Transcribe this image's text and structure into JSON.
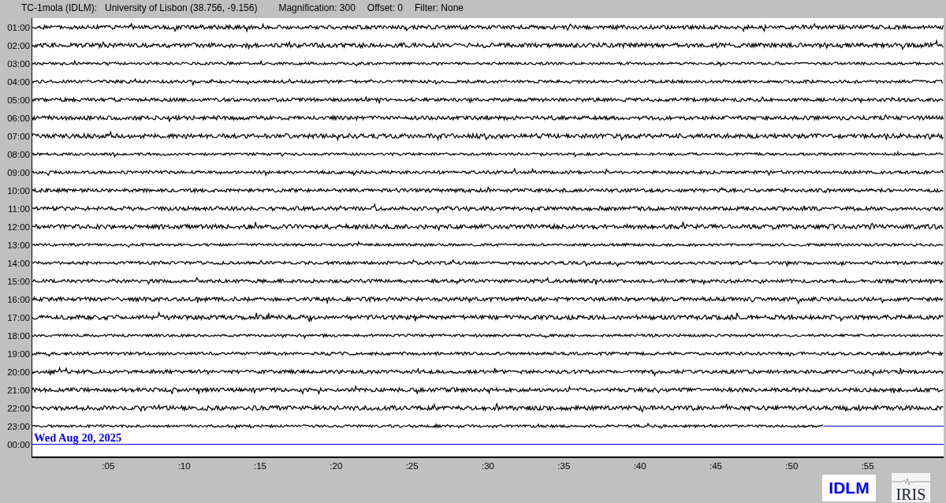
{
  "header": {
    "station": "TC-1mola (IDLM):",
    "location": "University of Lisbon (38.756, -9.156)",
    "magnification": "Magnification: 300",
    "offset": "Offset: 0",
    "filter": "Filter: None"
  },
  "rows": [
    {
      "time": "01:00",
      "kind": "trace"
    },
    {
      "time": "02:00",
      "kind": "trace"
    },
    {
      "time": "03:00",
      "kind": "trace"
    },
    {
      "time": "04:00",
      "kind": "trace"
    },
    {
      "time": "05:00",
      "kind": "trace"
    },
    {
      "time": "06:00",
      "kind": "trace"
    },
    {
      "time": "07:00",
      "kind": "trace"
    },
    {
      "time": "08:00",
      "kind": "trace"
    },
    {
      "time": "09:00",
      "kind": "trace"
    },
    {
      "time": "10:00",
      "kind": "trace"
    },
    {
      "time": "11:00",
      "kind": "trace"
    },
    {
      "time": "12:00",
      "kind": "trace"
    },
    {
      "time": "13:00",
      "kind": "trace"
    },
    {
      "time": "14:00",
      "kind": "trace"
    },
    {
      "time": "15:00",
      "kind": "trace"
    },
    {
      "time": "16:00",
      "kind": "trace"
    },
    {
      "time": "17:00",
      "kind": "trace"
    },
    {
      "time": "18:00",
      "kind": "trace"
    },
    {
      "time": "19:00",
      "kind": "trace"
    },
    {
      "time": "20:00",
      "kind": "trace"
    },
    {
      "time": "21:00",
      "kind": "trace"
    },
    {
      "time": "22:00",
      "kind": "trace"
    },
    {
      "time": "23:00",
      "kind": "partial"
    },
    {
      "time": "00:00",
      "kind": "flat"
    }
  ],
  "date_label": "Wed Aug 20, 2025",
  "x_axis": {
    "ticks": [
      ":05",
      ":10",
      ":15",
      ":20",
      ":25",
      ":30",
      ":35",
      ":40",
      ":45",
      ":50",
      ":55"
    ]
  },
  "logos": [
    {
      "text": "IDLM",
      "kind": "box"
    },
    {
      "text": "IRIS",
      "kind": "iris"
    }
  ]
}
